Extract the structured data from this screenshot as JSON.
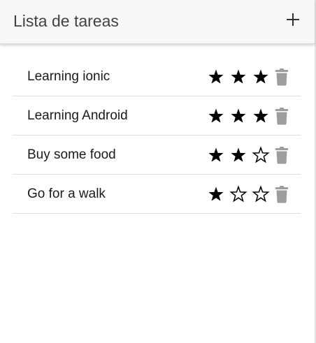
{
  "header": {
    "title": "Lista de tareas",
    "add_icon": "plus-icon"
  },
  "tasks": [
    {
      "label": "Learning ionic",
      "rating": 3,
      "max_rating": 3
    },
    {
      "label": "Learning Android",
      "rating": 3,
      "max_rating": 3
    },
    {
      "label": "Buy some food",
      "rating": 2,
      "max_rating": 3
    },
    {
      "label": "Go for a walk",
      "rating": 1,
      "max_rating": 3
    }
  ],
  "icons": {
    "star_filled": "star-filled-icon",
    "star_empty": "star-outline-icon",
    "delete": "trash-icon"
  },
  "colors": {
    "header_bg": "#f7f7f7",
    "star": "#000000",
    "trash": "#9e9e9e",
    "divider": "#dcdcdc"
  }
}
